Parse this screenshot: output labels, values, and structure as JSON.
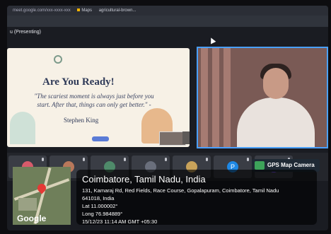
{
  "topbar": {
    "url": "meet.google.com/xxx-xxxx-xxx",
    "tab1": "Maps",
    "tab2": "agricultural-brown..."
  },
  "presenting_label": "u (Presenting)",
  "slide": {
    "title": "Are You Ready!",
    "quote": "\"The scariest moment is always just before you start. After that, things can only get better.\" -",
    "author": "Stephen King"
  },
  "participants": [
    {
      "initial": "",
      "color": "#d75b6b"
    },
    {
      "initial": "",
      "color": "#b9785b"
    },
    {
      "initial": "",
      "color": "#4f8a6a"
    },
    {
      "initial": "",
      "color": "#6a6f7c"
    },
    {
      "initial": "",
      "color": "#c8a25a"
    },
    {
      "initial": "P",
      "color": "#1e88e5"
    },
    {
      "initial": "",
      "color": "#7c4dff"
    }
  ],
  "gps": {
    "badge": "GPS Map Camera",
    "city": "Coimbatore, Tamil Nadu, India",
    "address": "131, Kamaraj Rd, Red Fields, Race Course, Gopalapuram, Coimbatore, Tamil Nadu 641018, India",
    "lat": "Lat 11.000002°",
    "long": "Long 76.984889°",
    "datetime": "15/12/23 11:14 AM GMT +05:30",
    "map_brand": "Google"
  }
}
